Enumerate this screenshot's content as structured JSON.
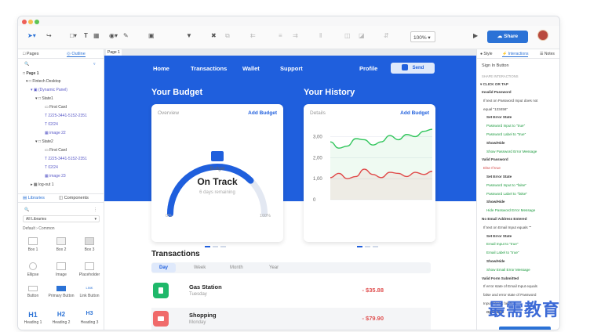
{
  "toolbar": {
    "zoom": "100%",
    "share_label": "Share"
  },
  "left_panel": {
    "tabs": [
      "Pages",
      "Outline"
    ],
    "tree": [
      "Page 1",
      "Fintech Desktop",
      "(Dynamic Panel)",
      "State1",
      "First Card",
      "2225-3441-5152-2351",
      "02/24",
      "image 22",
      "State2",
      "First Card",
      "2225-3441-5152-2351",
      "02/24",
      "image 23",
      "log-out 1"
    ],
    "lib_tabs": [
      "Libraries",
      "Components"
    ],
    "lib_select": "All Libraries",
    "lib_section": "Default › Common",
    "widgets": [
      {
        "label": "Box 1"
      },
      {
        "label": "Box 2"
      },
      {
        "label": "Box 3"
      },
      {
        "label": "Ellipse"
      },
      {
        "label": "Image"
      },
      {
        "label": "Placeholder"
      },
      {
        "label": "Button"
      },
      {
        "label": "Primary Button"
      },
      {
        "label": "Link Button"
      },
      {
        "label": "Heading 1",
        "glyph": "H1"
      },
      {
        "label": "Heading 2",
        "glyph": "H2"
      },
      {
        "label": "Heading 3",
        "glyph": "H3"
      }
    ]
  },
  "canvas": {
    "page_tab": "Page 1",
    "nav": {
      "home": "Home",
      "transactions": "Transactions",
      "wallet": "Wallet",
      "support": "Support",
      "profile": "Profile",
      "send": "Send"
    },
    "budget": {
      "section_title": "Your Budget",
      "tab": "Overview",
      "action": "Add Budget",
      "label": "Budget",
      "status": "On Track",
      "remaining": "6 days remaining",
      "min": "0%",
      "max": "100%",
      "progress": 0.75
    },
    "history": {
      "section_title": "Your History",
      "tab": "Details",
      "action": "Add Budget"
    },
    "transactions": {
      "title": "Transactions",
      "filters": [
        "Day",
        "Week",
        "Month",
        "Year"
      ],
      "active_filter": "Day",
      "items": [
        {
          "name": "Gas Station",
          "day": "Tuesday",
          "amount": "- $35.88",
          "color": "#1fb86a"
        },
        {
          "name": "Shopping",
          "day": "Monday",
          "amount": "- $79.90",
          "color": "#f06a6a"
        }
      ]
    }
  },
  "chart_data": {
    "type": "line",
    "title": "",
    "xlabel": "",
    "ylabel": "",
    "y_ticks": [
      "3,00",
      "2,00",
      "1,00",
      "0"
    ],
    "ylim": [
      0,
      3.5
    ],
    "x": [
      0,
      1,
      2,
      3,
      4,
      5,
      6,
      7,
      8,
      9,
      10,
      11,
      12
    ],
    "series": [
      {
        "values": [
          2.75,
          2.45,
          2.55,
          2.9,
          2.85,
          2.6,
          2.75,
          3.05,
          2.85,
          3.1,
          3.0,
          3.25,
          3.35
        ],
        "color": "#2fc55a"
      },
      {
        "values": [
          1.05,
          1.25,
          1.0,
          1.1,
          1.45,
          1.2,
          1.05,
          1.3,
          1.25,
          1.1,
          1.3,
          1.2,
          1.35
        ],
        "color": "#e04848"
      }
    ],
    "grid": true
  },
  "right_panel": {
    "tabs": [
      "Style",
      "Interactions",
      "Notes"
    ],
    "active_tab": "Interactions",
    "widget_name": "Sign In Button",
    "section": "SHAPE INTERACTIONS",
    "event": "CLICK OR TAP",
    "lines": [
      {
        "t": "Invalid Password",
        "c": "ev-red"
      },
      {
        "t": "If text on Password Input does not",
        "c": ""
      },
      {
        "t": "equal \"123456\"",
        "c": ""
      },
      {
        "t": "Set Error State",
        "c": "ev-red"
      },
      {
        "t": "Password Input to \"true\"",
        "c": "g"
      },
      {
        "t": "Password Label to \"true\"",
        "c": "g"
      },
      {
        "t": "Show/Hide",
        "c": "ev-red"
      },
      {
        "t": "Show Password Error Message",
        "c": "g"
      },
      {
        "t": "Valid Password",
        "c": "ev-red"
      },
      {
        "t": "Else If true",
        "c": "r"
      },
      {
        "t": "Set Error State",
        "c": "ev-red"
      },
      {
        "t": "Password Input to \"false\"",
        "c": "g"
      },
      {
        "t": "Password Label to \"false\"",
        "c": "g"
      },
      {
        "t": "Show/Hide",
        "c": "ev-red"
      },
      {
        "t": "Hide Password Error Message",
        "c": "g"
      },
      {
        "t": "No Email Address Entered",
        "c": "ev-red"
      },
      {
        "t": "If text on Email Input equals \"\"",
        "c": ""
      },
      {
        "t": "Set Error State",
        "c": "ev-red"
      },
      {
        "t": "Email Input to \"true\"",
        "c": "g"
      },
      {
        "t": "Email Label to \"true\"",
        "c": "g"
      },
      {
        "t": "Show/Hide",
        "c": "ev-red"
      },
      {
        "t": "Show Email Error Message",
        "c": "g"
      },
      {
        "t": "Valid Form Submitted",
        "c": "ev-red"
      },
      {
        "t": "If error state of Email Input equals",
        "c": ""
      },
      {
        "t": "false and error state of Password",
        "c": ""
      },
      {
        "t": "Input equals false",
        "c": ""
      },
      {
        "t": "Open Link",
        "c": "ev-red"
      }
    ]
  },
  "watermark": "最需教育"
}
